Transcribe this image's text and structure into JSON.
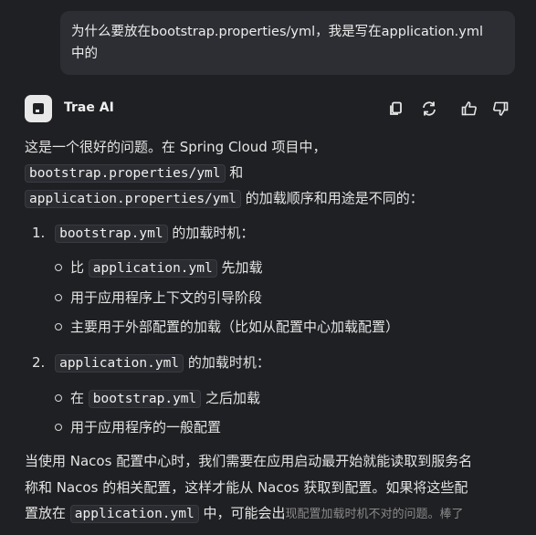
{
  "user_message": {
    "line1": "为什么要放在bootstrap.properties/yml，我是写在application.yml",
    "line2": "中的"
  },
  "assistant": {
    "name": "Trae AI",
    "actions": [
      "copy-icon",
      "refresh-icon",
      "thumbs-up-icon",
      "thumbs-down-icon"
    ]
  },
  "answer": {
    "intro_a": "这是一个很好的问题。在 Spring Cloud 项目中，",
    "intro_code1": "bootstrap.properties/yml",
    "intro_b": " 和",
    "intro_code2": "application.properties/yml",
    "intro_c": " 的加载顺序和用途是不同的：",
    "item1": {
      "number": "1.",
      "code": "bootstrap.yml",
      "text": " 的加载时机：",
      "bullets": [
        {
          "pre": "比 ",
          "code": "application.yml",
          "post": " 先加载"
        },
        {
          "pre": "用于应用程序上下文的引导阶段",
          "code": "",
          "post": ""
        },
        {
          "pre": "主要用于外部配置的加载（比如从配置中心加载配置）",
          "code": "",
          "post": ""
        }
      ]
    },
    "item2": {
      "number": "2.",
      "code": "application.yml",
      "text": " 的加载时机：",
      "bullets": [
        {
          "pre": "在 ",
          "code": "bootstrap.yml",
          "post": " 之后加载"
        },
        {
          "pre": "用于应用程序的一般配置",
          "code": "",
          "post": ""
        }
      ]
    },
    "para_line1": "当使用 Nacos 配置中心时，我们需要在应用启动最开始就能读取到服务名",
    "para_line2": "称和 Nacos 的相关配置，这样才能从 Nacos 获取到配置。如果将这些配",
    "para_line3_a": "置放在 ",
    "para_line3_code": "application.yml",
    "para_line3_b": " 中，可能会出",
    "watermark": "现配置加载时机不对的问题。棒了"
  }
}
